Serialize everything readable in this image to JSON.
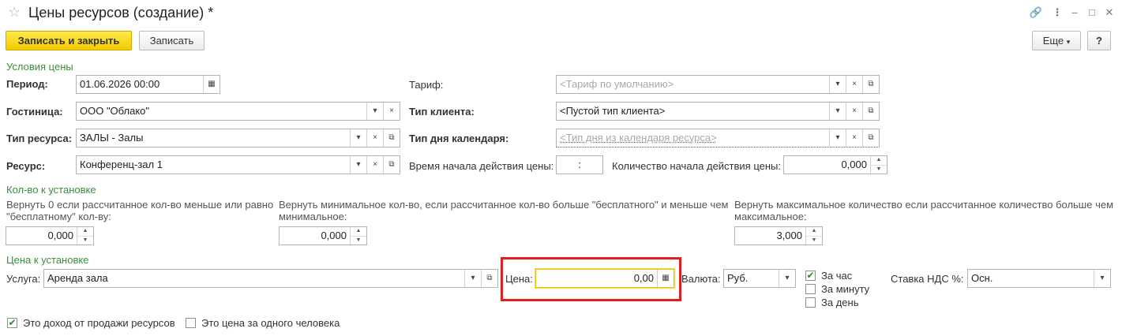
{
  "window": {
    "title": "Цены ресурсов (создание) *",
    "star_icon": "star-icon",
    "icons": [
      "link-icon",
      "more-vertical-icon",
      "minimize-icon",
      "maximize-icon",
      "close-icon"
    ]
  },
  "toolbar": {
    "save_close_label": "Записать и закрыть",
    "save_label": "Записать",
    "more_label": "Еще",
    "more_arrow": "▾",
    "help_label": "?"
  },
  "conditions": {
    "section_title": "Условия цены",
    "period": {
      "label": "Период:",
      "value": "01.06.2026 00:00"
    },
    "hotel": {
      "label": "Гостиница:",
      "value": "ООО \"Облако\""
    },
    "resource_type": {
      "label": "Тип ресурса:",
      "value": "ЗАЛЫ - Залы"
    },
    "resource": {
      "label": "Ресурс:",
      "value": "Конференц-зал 1"
    },
    "tariff": {
      "label": "Тариф:",
      "placeholder": "<Тариф по умолчанию>"
    },
    "client_type": {
      "label": "Тип клиента:",
      "value": "<Пустой тип клиента>"
    },
    "calendar_day_type": {
      "label": "Тип дня календаря:",
      "placeholder": "<Тип дня из календаря ресурса>"
    },
    "start_time": {
      "label": "Время начала действия цены:",
      "value": " : "
    },
    "start_qty": {
      "label": "Количество начала действия цены:",
      "value": "0,000"
    }
  },
  "quantity": {
    "section_title": "Кол-во к установке",
    "zero_if_less": {
      "label_line1": "Вернуть 0 если рассчитанное кол-во меньше или равно",
      "label_line2": "\"бесплатному\" кол-ву:",
      "value": "0,000"
    },
    "min_if_between": {
      "label_line1": "Вернуть минимальное кол-во, если рассчитанное кол-во больше \"бесплатного\" и меньше чем",
      "label_line2": "минимальное:",
      "value": "0,000"
    },
    "max_if_greater": {
      "label_line1": "Вернуть максимальное количество если рассчитанное количество больше чем",
      "label_line2": "максимальное:",
      "value": "3,000"
    }
  },
  "price": {
    "section_title": "Цена к установке",
    "service": {
      "label": "Услуга:",
      "value": "Аренда зала"
    },
    "price": {
      "label": "Цена:",
      "value": "0,00"
    },
    "currency": {
      "label": "Валюта:",
      "value": "Руб."
    },
    "per_hour": {
      "label": "За час",
      "checked": true
    },
    "per_minute": {
      "label": "За минуту",
      "checked": false
    },
    "per_day": {
      "label": "За день",
      "checked": false
    },
    "vat": {
      "label": "Ставка НДС %:",
      "value": "Осн."
    }
  },
  "options": {
    "revenue": {
      "label": "Это доход от продажи ресурсов",
      "checked": true
    },
    "per_person": {
      "label": "Это цена за одного человека",
      "checked": false
    }
  },
  "accent_colors": {
    "section": "#3b8f3b",
    "primary_button": "#f2cb00",
    "highlight": "#e02020"
  }
}
